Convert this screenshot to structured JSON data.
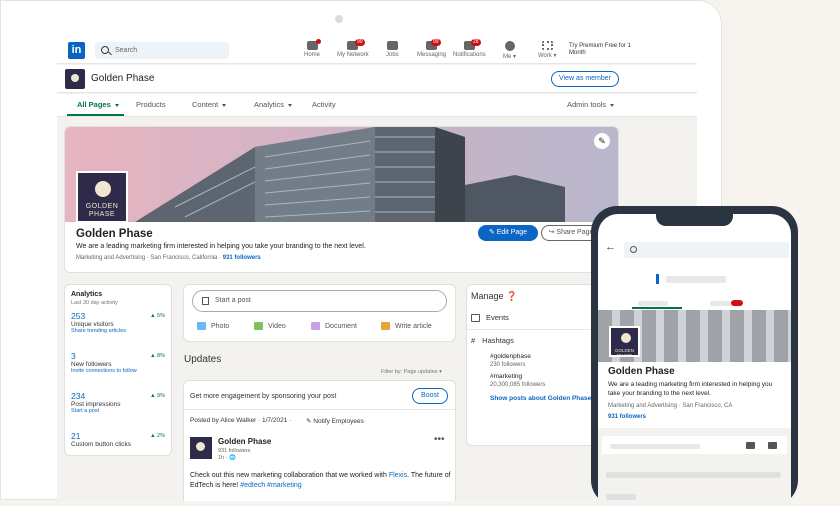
{
  "nav": {
    "logo": "in",
    "search_placeholder": "Search",
    "items": [
      {
        "label": "Home",
        "badge": ""
      },
      {
        "label": "My Network",
        "badge": "99"
      },
      {
        "label": "Jobs",
        "badge": ""
      },
      {
        "label": "Messaging",
        "badge": "99"
      },
      {
        "label": "Notifications",
        "badge": "28"
      },
      {
        "label": "Me ▾",
        "badge": ""
      },
      {
        "label": "Work ▾",
        "badge": ""
      }
    ],
    "premium": "Try Premium Free for 1 Month"
  },
  "page_bar": {
    "name": "Golden Phase",
    "view_as_member": "View as member"
  },
  "tabs": {
    "all_pages": "All Pages",
    "products": "Products",
    "content": "Content",
    "analytics": "Analytics",
    "activity": "Activity",
    "admin_tools": "Admin tools"
  },
  "hero": {
    "logo_line1": "GOLDEN",
    "logo_line2": "PHASE",
    "name": "Golden Phase",
    "tagline": "We are a leading marketing firm interested in helping you take your branding to the next level.",
    "meta": "Marketing and Advertising · San Francisco, California ·",
    "followers": "931 followers",
    "edit_page": "Edit Page",
    "share_page": "Share Page"
  },
  "analytics": {
    "title": "Analytics",
    "subtitle": "Last 30 day activity",
    "stats": [
      {
        "num": "253",
        "label": "Unique visitors",
        "link": "Share trending articles",
        "pct": "5%"
      },
      {
        "num": "3",
        "label": "New followers",
        "link": "Invite connections to follow",
        "pct": "8%"
      },
      {
        "num": "234",
        "label": "Post impressions",
        "link": "Start a post",
        "pct": "9%"
      },
      {
        "num": "21",
        "label": "Custom button clicks",
        "link": "",
        "pct": "2%"
      }
    ]
  },
  "start_post": {
    "placeholder": "Start a post",
    "photo": "Photo",
    "video": "Video",
    "document": "Document",
    "write_article": "Write article"
  },
  "updates": {
    "title": "Updates",
    "filter": "Filter by: Page updates ▾"
  },
  "post": {
    "sponsor_text": "Get more engagement by sponsoring your post",
    "boost": "Boost",
    "posted_by": "Posted by Alice Walker · 1/7/2021 ·",
    "notify": "Notify Employees",
    "author": "Golden Phase",
    "author_followers": "931 followers",
    "time": "1h · 🌐",
    "text_a": "Check out this new marketing collaboration that we worked with ",
    "text_link": "Flexis",
    "text_b": ". The future of EdTech is here! ",
    "hashtags": "#edtech #marketing"
  },
  "manage": {
    "title": "Manage ❓",
    "events": "Events",
    "hashtags": "Hashtags",
    "tags": [
      {
        "tag": "#goldenphase",
        "followers": "230 followers"
      },
      {
        "tag": "#marketing",
        "followers": "20,300,085 followers"
      }
    ],
    "show_posts": "Show posts about Golden Phase"
  },
  "phone": {
    "logo_line1": "GOLDEN",
    "logo_line2": "PHASE",
    "name": "Golden Phase",
    "tagline": "We are a leading marketing firm interested in helping you take your branding to the next level.",
    "meta": "Marketing and Advertising · San Francisco, CA",
    "followers": "931 followers"
  }
}
